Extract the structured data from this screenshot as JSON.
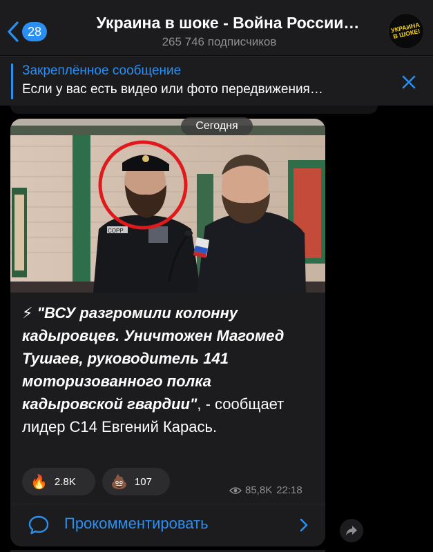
{
  "header": {
    "back_count": "28",
    "title": "Украина в шоке - Война России…",
    "subtitle": "265 746 подписчиков",
    "avatar_text": "УКРАИНА В ШОКЕ!"
  },
  "pinned": {
    "label": "Закреплённое сообщение",
    "text": "Если у вас есть видео или фото передвижения…"
  },
  "post": {
    "date_chip": "Сегодня",
    "lightning": "⚡",
    "quote": "\"ВСУ разгромили колонну кадыровцев. Уничтожен Магомед Тушаев, руководитель 141 моторизованного полка кадыровской гвардии\"",
    "rest": ", - сообщает лидер С14 Евгений Карась.",
    "photo_patch": "COPP",
    "reactions": [
      {
        "emoji": "🔥",
        "icon": "fire-icon",
        "count": "2.8K"
      },
      {
        "emoji": "💩",
        "icon": "poop-icon",
        "count": "107"
      }
    ],
    "views": "85,8K",
    "time": "22:18"
  },
  "comment": {
    "label": "Прокомментировать"
  },
  "colors": {
    "accent": "#2b8ff2",
    "bubble": "#1c1c1e",
    "header": "#1c1c1e",
    "muted": "#8e8e93",
    "highlight_circle": "#e0191c"
  }
}
